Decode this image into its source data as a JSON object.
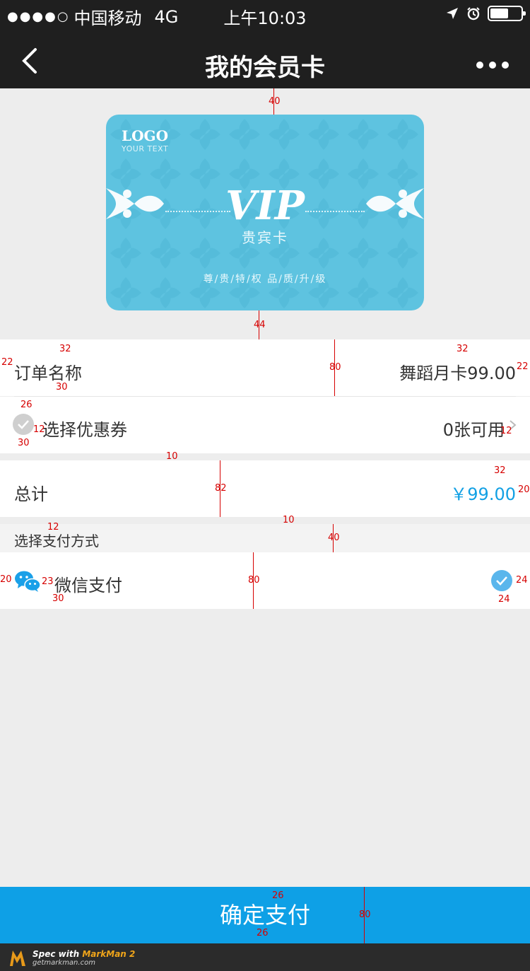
{
  "status_bar": {
    "carrier": "中国移动",
    "network": "4G",
    "time": "上午10:03"
  },
  "nav": {
    "title": "我的会员卡"
  },
  "card": {
    "logo": "LOGO",
    "logo_sub": "YOUR TEXT",
    "vip": "VIP",
    "name": "贵宾卡",
    "tagline": "尊/贵/特/权   品/质/升/级",
    "color": "#5ec3e0"
  },
  "order": {
    "label": "订单名称",
    "value": "舞蹈月卡99.00"
  },
  "coupon": {
    "label": "选择优惠券",
    "value": "0张可用"
  },
  "total": {
    "label": "总计",
    "value": "￥99.00",
    "color": "#12a0e4"
  },
  "payment": {
    "section_title": "选择支付方式",
    "method": "微信支付"
  },
  "confirm_button": "确定支付",
  "branding": {
    "line1_prefix": "Spec with ",
    "line1_brand": "MarkMan 2",
    "line2": "getmarkman.com"
  },
  "annotations": [
    "40",
    "44",
    "32",
    "22",
    "30",
    "80",
    "26",
    "12",
    "10",
    "82",
    "20",
    "23",
    "24"
  ]
}
